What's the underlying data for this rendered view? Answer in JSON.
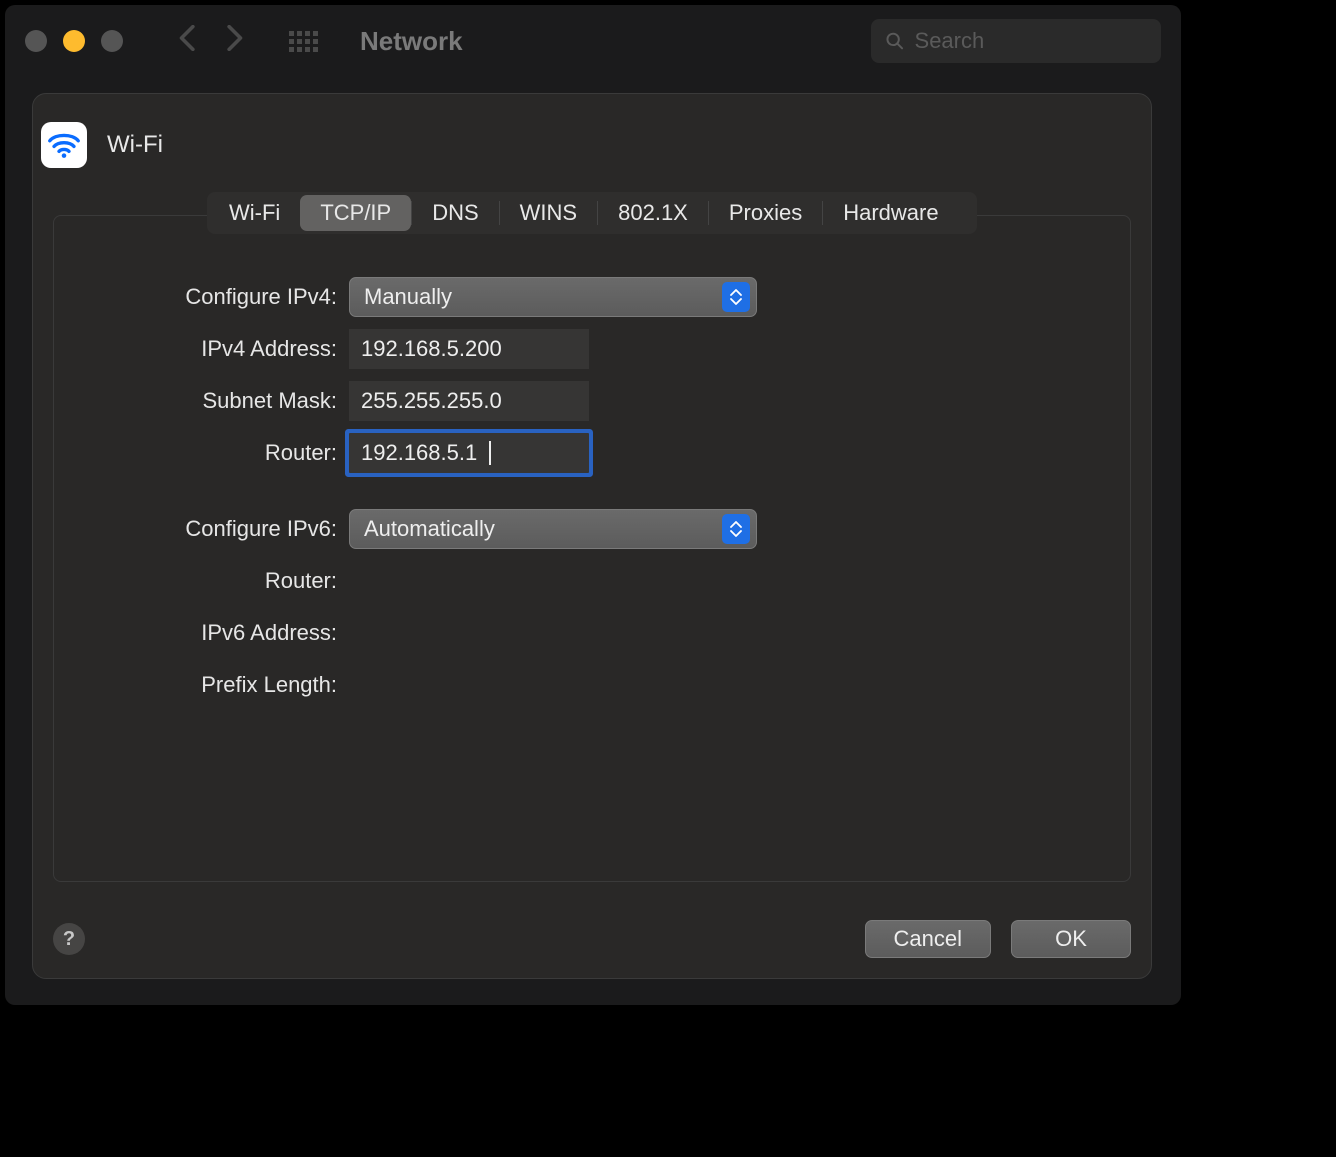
{
  "window": {
    "title": "Network",
    "search_placeholder": "Search"
  },
  "sheet": {
    "title": "Wi-Fi",
    "tabs": [
      "Wi-Fi",
      "TCP/IP",
      "DNS",
      "WINS",
      "802.1X",
      "Proxies",
      "Hardware"
    ],
    "selected_tab_index": 1,
    "ipv4": {
      "configure_label": "Configure IPv4:",
      "configure_value": "Manually",
      "address_label": "IPv4 Address:",
      "address_value": "192.168.5.200",
      "subnet_label": "Subnet Mask:",
      "subnet_value": "255.255.255.0",
      "router_label": "Router:",
      "router_value": "192.168.5.1"
    },
    "ipv6": {
      "configure_label": "Configure IPv6:",
      "configure_value": "Automatically",
      "router_label": "Router:",
      "address_label": "IPv6 Address:",
      "prefix_label": "Prefix Length:"
    },
    "buttons": {
      "cancel": "Cancel",
      "ok": "OK"
    }
  }
}
